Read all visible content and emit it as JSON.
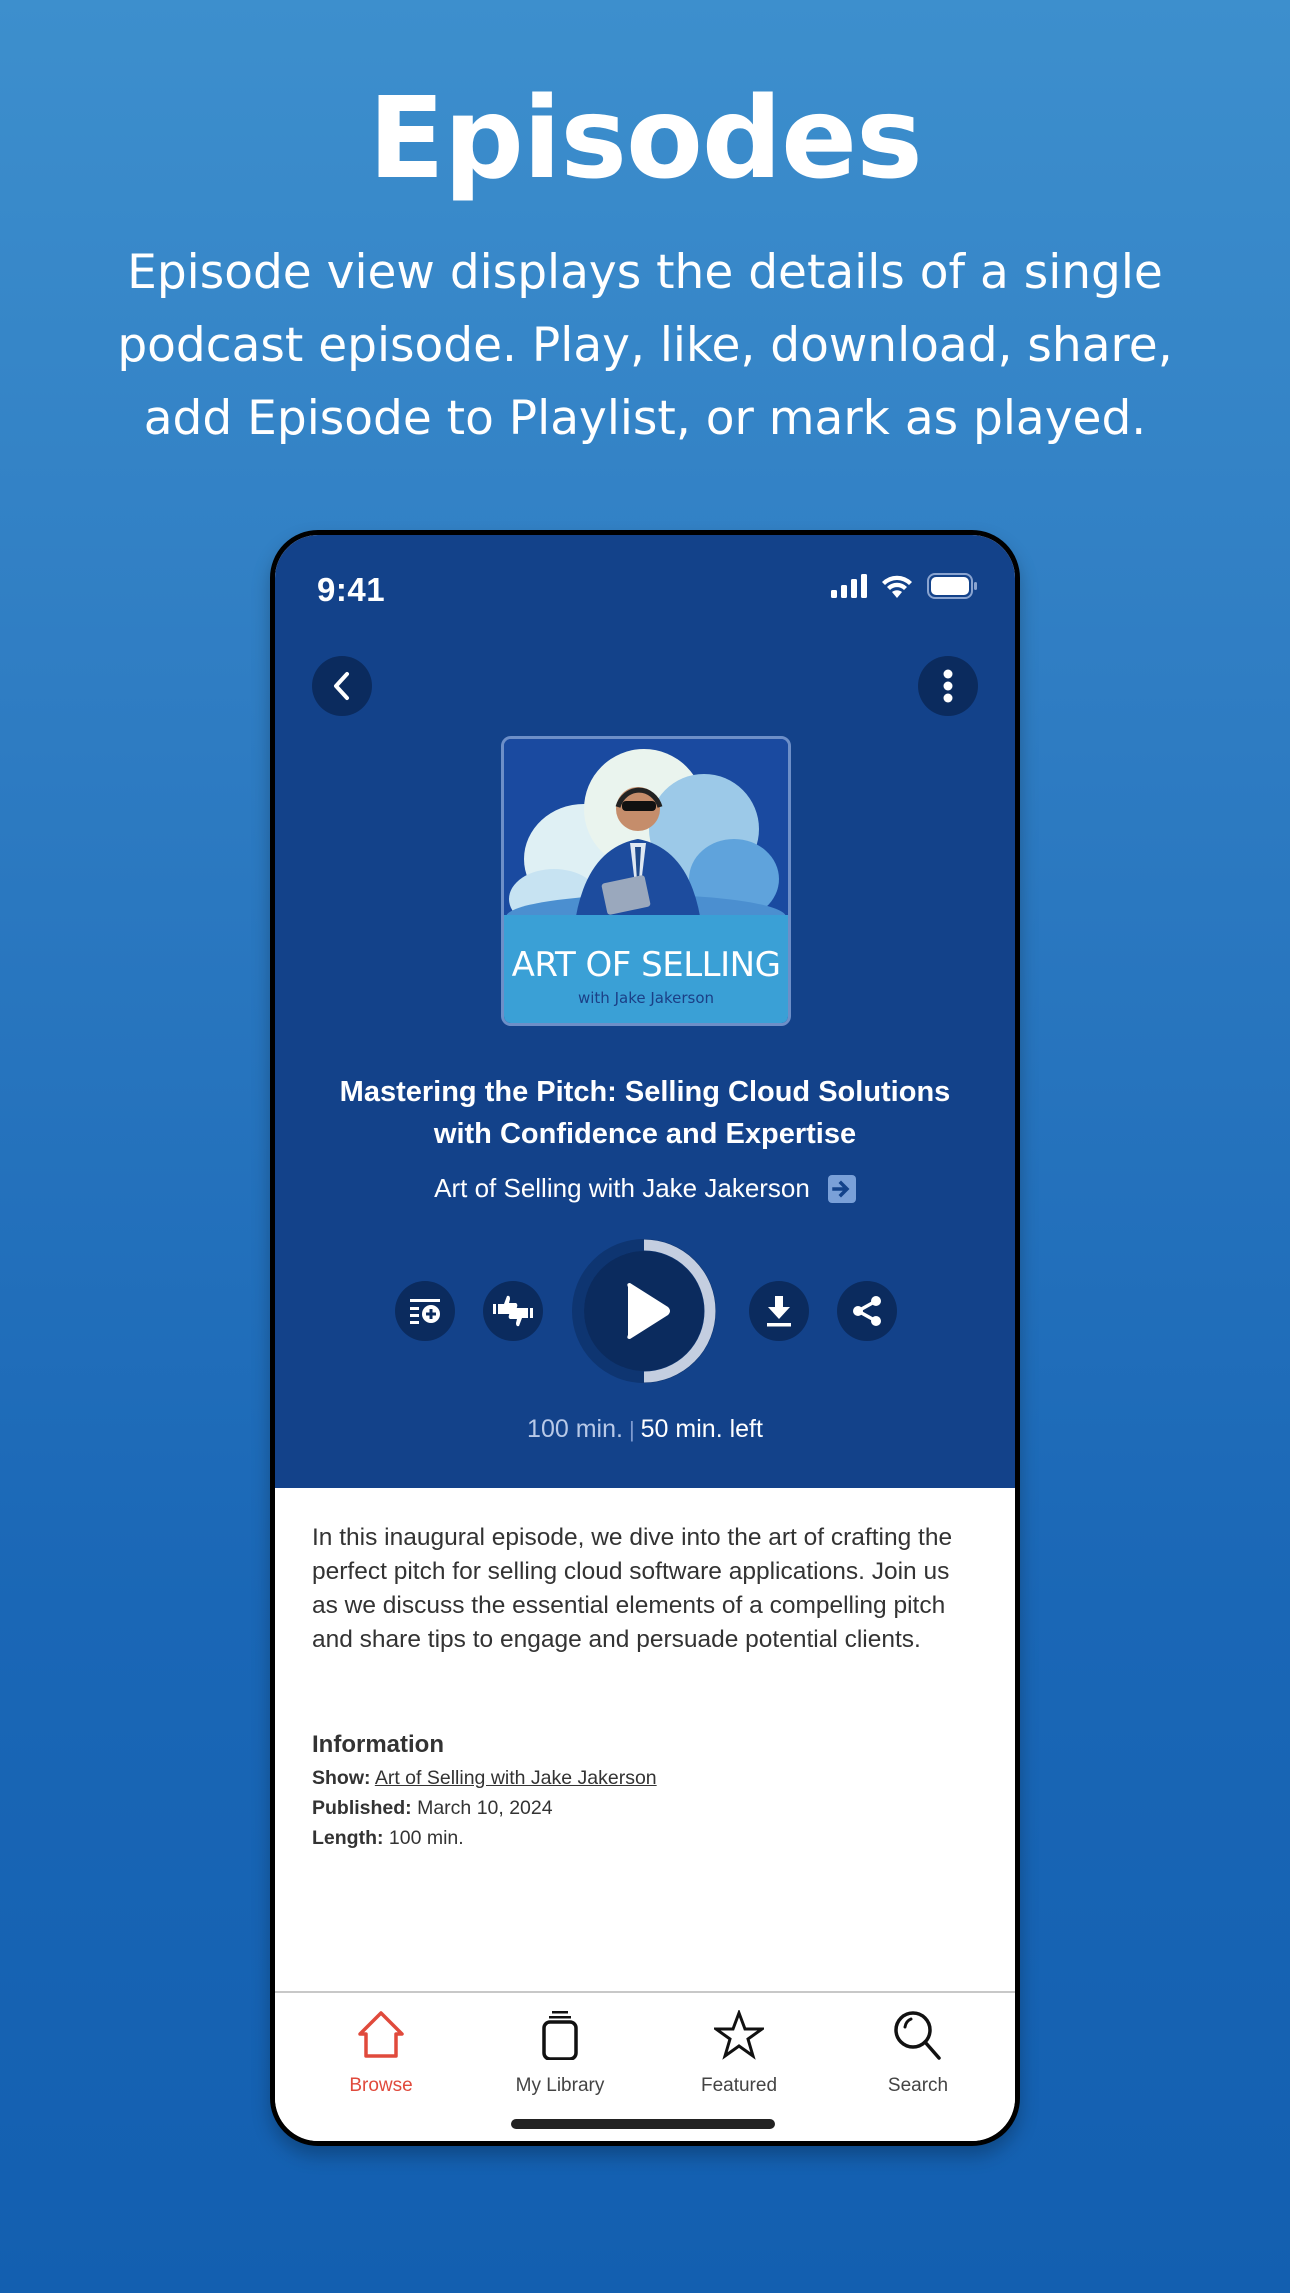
{
  "hero": {
    "title": "Episodes",
    "subtitle": "Episode view displays the details of a single podcast episode. Play, like, download, share, add Episode to Playlist, or mark as played."
  },
  "status_bar": {
    "time": "9:41",
    "icons": [
      "signal-icon",
      "wifi-icon",
      "battery-icon"
    ]
  },
  "nav": {
    "back_icon": "chevron-left-icon",
    "more_icon": "more-vertical-icon"
  },
  "artwork": {
    "title": "ART OF SELLING",
    "subtitle": "with Jake Jakerson"
  },
  "episode": {
    "title": "Mastering the Pitch: Selling Cloud Solutions with Confidence and Expertise",
    "show_name": "Art of Selling with Jake Jakerson",
    "description": "In this inaugural episode, we dive into the art of crafting the perfect pitch for selling cloud software applications. Join us as we discuss the essential elements of a compelling pitch and share tips to engage and persuade potential clients."
  },
  "controls": {
    "add_to_playlist_icon": "playlist-add-icon",
    "rate_icon": "thumbs-up-down-icon",
    "play_icon": "play-icon",
    "download_icon": "download-icon",
    "share_icon": "share-icon",
    "progress_fraction": 0.5
  },
  "time": {
    "total": "100 min.",
    "separator": "|",
    "remaining": "50 min. left"
  },
  "information": {
    "heading": "Information",
    "show_label": "Show:",
    "show_value": "Art of Selling with Jake Jakerson",
    "published_label": "Published:",
    "published_value": "March 10, 2024",
    "length_label": "Length:",
    "length_value": "100 min."
  },
  "tabbar": {
    "active_color": "#e04a3c",
    "items": [
      {
        "label": "Browse",
        "icon": "home-icon",
        "active": true
      },
      {
        "label": "My Library",
        "icon": "library-icon",
        "active": false
      },
      {
        "label": "Featured",
        "icon": "star-icon",
        "active": false
      },
      {
        "label": "Search",
        "icon": "search-icon",
        "active": false
      }
    ]
  }
}
